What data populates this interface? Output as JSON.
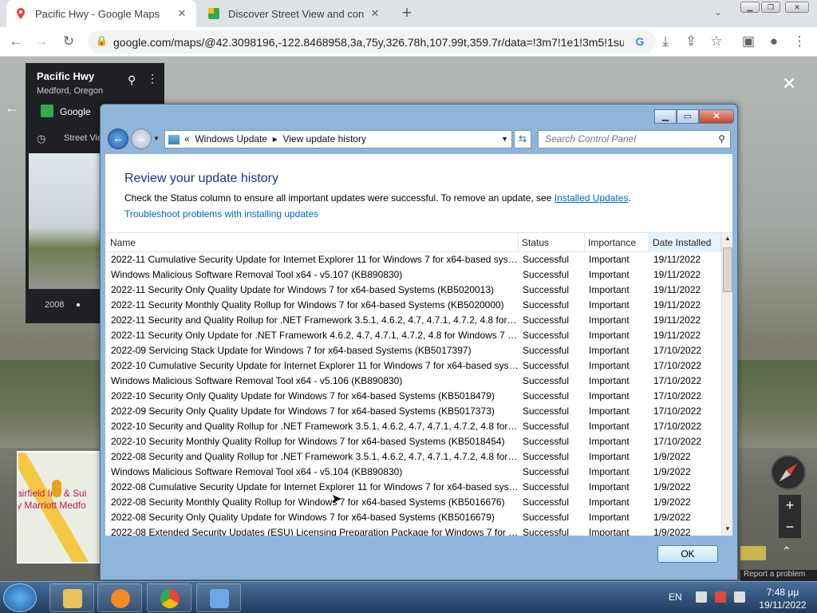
{
  "browser": {
    "tabs": [
      {
        "title": "Pacific Hwy - Google Maps",
        "active": true
      },
      {
        "title": "Discover Street View and contrib",
        "active": false
      }
    ],
    "url": "google.com/maps/@42.3098196,-122.8468958,3a,75y,326.78h,107.99t,359.7r/data=!3m7!1e1!3m5!1su..."
  },
  "maps": {
    "place_title": "Pacific Hwy",
    "place_sub": "Medford, Oregon",
    "google_label": "Google",
    "streetview_label": "Street Vie",
    "year": "2008",
    "minimap_label": "airfield Inn & Sui\ny Marriott Medfo",
    "report": "Report a problem"
  },
  "dialog": {
    "addr_prefix": "«",
    "addr_crumb1": "Windows Update",
    "addr_crumb2": "View update history",
    "search_placeholder": "Search Control Panel",
    "heading": "Review your update history",
    "desc": "Check the Status column to ensure all important updates were successful. To remove an update, see ",
    "desc_link": "Installed Updates",
    "desc_end": ".",
    "trouble": "Troubleshoot problems with installing updates",
    "columns": [
      "Name",
      "Status",
      "Importance",
      "Date Installed"
    ],
    "rows": [
      [
        "2022-11 Cumulative Security Update for Internet Explorer 11 for Windows 7 for x64-based syste...",
        "Successful",
        "Important",
        "19/11/2022"
      ],
      [
        "Windows Malicious Software Removal Tool x64 - v5.107 (KB890830)",
        "Successful",
        "Important",
        "19/11/2022"
      ],
      [
        "2022-11 Security Only Quality Update for Windows 7 for x64-based Systems (KB5020013)",
        "Successful",
        "Important",
        "19/11/2022"
      ],
      [
        "2022-11 Security Monthly Quality Rollup for Windows 7 for x64-based Systems (KB5020000)",
        "Successful",
        "Important",
        "19/11/2022"
      ],
      [
        "2022-11 Security and Quality Rollup for .NET Framework 3.5.1, 4.6.2, 4.7, 4.7.1, 4.7.2, 4.8 for Win...",
        "Successful",
        "Important",
        "19/11/2022"
      ],
      [
        "2022-11 Security Only Update for .NET Framework 4.6.2, 4.7, 4.7.1, 4.7.2, 4.8 for Windows 7 for x...",
        "Successful",
        "Important",
        "19/11/2022"
      ],
      [
        "2022-09 Servicing Stack Update for Windows 7 for x64-based Systems (KB5017397)",
        "Successful",
        "Important",
        "17/10/2022"
      ],
      [
        "2022-10 Cumulative Security Update for Internet Explorer 11 for Windows 7 for x64-based syste...",
        "Successful",
        "Important",
        "17/10/2022"
      ],
      [
        "Windows Malicious Software Removal Tool x64 - v5.106 (KB890830)",
        "Successful",
        "Important",
        "17/10/2022"
      ],
      [
        "2022-10 Security Only Quality Update for Windows 7 for x64-based Systems (KB5018479)",
        "Successful",
        "Important",
        "17/10/2022"
      ],
      [
        "2022-09 Security Only Quality Update for Windows 7 for x64-based Systems (KB5017373)",
        "Successful",
        "Important",
        "17/10/2022"
      ],
      [
        "2022-10 Security and Quality Rollup for .NET Framework 3.5.1, 4.6.2, 4.7, 4.7.1, 4.7.2, 4.8 for Win...",
        "Successful",
        "Important",
        "17/10/2022"
      ],
      [
        "2022-10 Security Monthly Quality Rollup for Windows 7 for x64-based Systems (KB5018454)",
        "Successful",
        "Important",
        "17/10/2022"
      ],
      [
        "2022-08 Security and Quality Rollup for .NET Framework 3.5.1, 4.6.2, 4.7, 4.7.1, 4.7.2, 4.8 for Win...",
        "Successful",
        "Important",
        "1/9/2022"
      ],
      [
        "Windows Malicious Software Removal Tool x64 - v5.104 (KB890830)",
        "Successful",
        "Important",
        "1/9/2022"
      ],
      [
        "2022-08 Cumulative Security Update for Internet Explorer 11 for Windows 7 for x64-based syste...",
        "Successful",
        "Important",
        "1/9/2022"
      ],
      [
        "2022-08 Security Monthly Quality Rollup for Windows 7 for x64-based Systems (KB5016676)",
        "Successful",
        "Important",
        "1/9/2022"
      ],
      [
        "2022-08 Security Only Quality Update for Windows 7 for x64-based Systems (KB5016679)",
        "Successful",
        "Important",
        "1/9/2022"
      ],
      [
        "2022-08 Extended Security Updates (ESU) Licensing Preparation Package for Windows 7 for x64-...",
        "Successful",
        "Important",
        "1/9/2022"
      ]
    ],
    "ok_label": "OK"
  },
  "taskbar": {
    "lang": "EN",
    "time": "7:48 μμ",
    "date": "19/11/2022"
  },
  "colors": {
    "heading": "#1e3287",
    "link": "#0066cc",
    "dialog_frame": "#8fb6d8"
  }
}
